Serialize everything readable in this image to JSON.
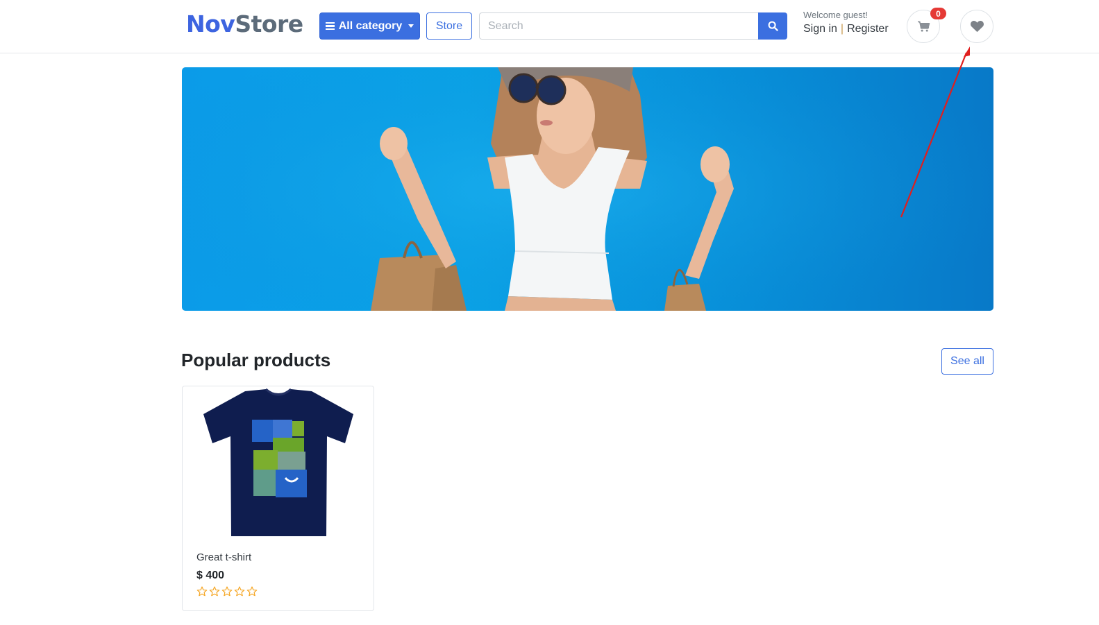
{
  "header": {
    "logo": {
      "part1": "Nov",
      "part2": "Store"
    },
    "category_button": "All category",
    "store_button": "Store",
    "search": {
      "placeholder": "Search",
      "value": ""
    },
    "welcome": "Welcome guest!",
    "sign_in": "Sign in",
    "separator": "|",
    "register": "Register",
    "cart_count": "0"
  },
  "popular": {
    "title": "Popular products",
    "see_all": "See all",
    "products": [
      {
        "name": "Great t-shirt",
        "price": "$ 400",
        "rating": 0,
        "max_rating": 5
      }
    ]
  },
  "colors": {
    "primary": "#3b6fe0",
    "badge": "#e53935",
    "banner": "#0a9be4",
    "annotation_arrow": "#e01e1e",
    "star": "#f5a623"
  },
  "icons": [
    "bars-icon",
    "caret-down-icon",
    "search-icon",
    "cart-icon",
    "heart-icon",
    "star-outline-icon"
  ]
}
